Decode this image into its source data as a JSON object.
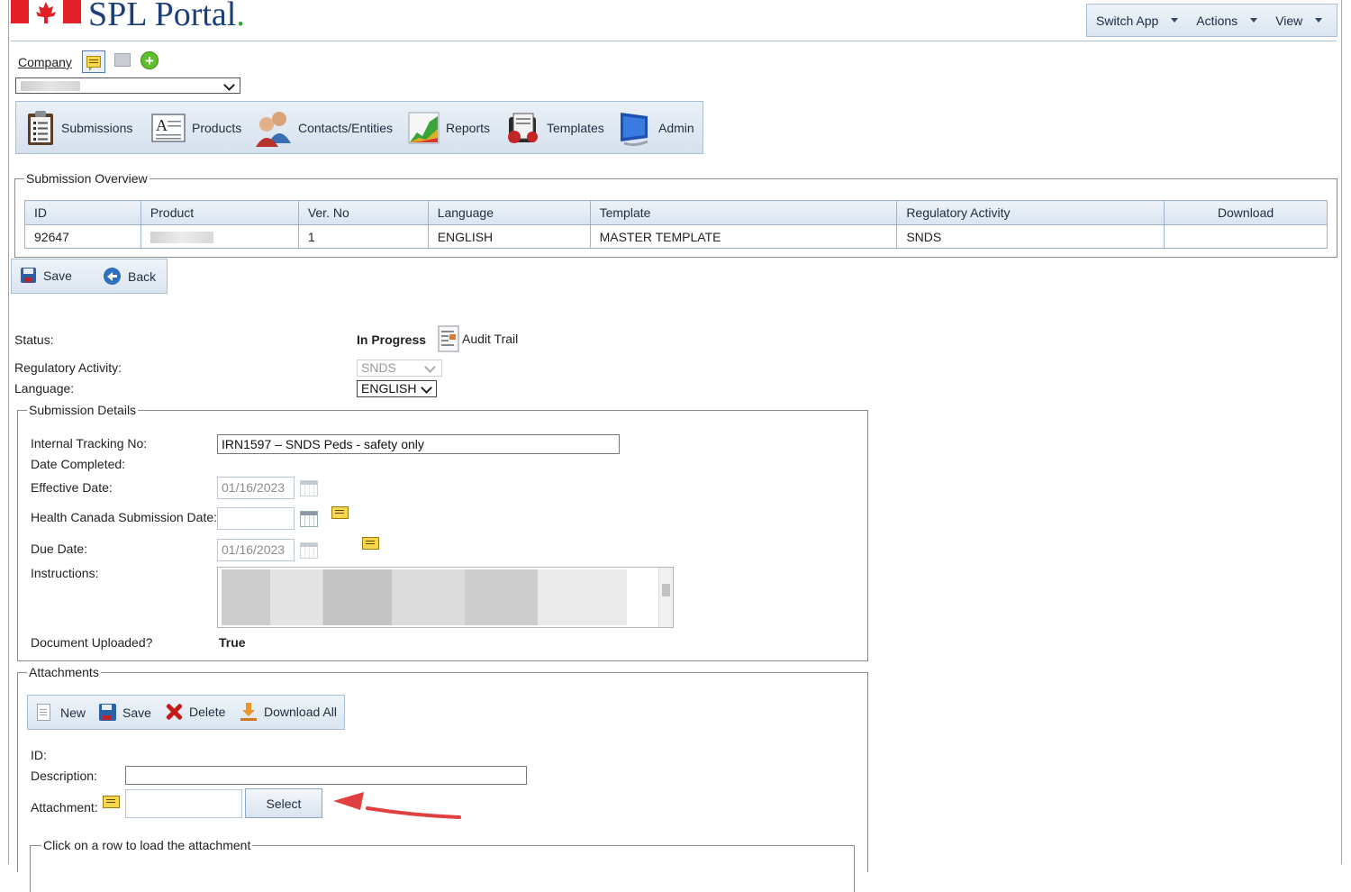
{
  "app": {
    "title": "SPL Portal"
  },
  "top_menu": {
    "items": [
      "Switch App",
      "Actions",
      "View"
    ]
  },
  "company": {
    "label": "Company"
  },
  "modules": [
    "Submissions",
    "Products",
    "Contacts/Entities",
    "Reports",
    "Templates",
    "Admin"
  ],
  "overview": {
    "legend": "Submission Overview",
    "columns": [
      "ID",
      "Product",
      "Ver. No",
      "Language",
      "Template",
      "Regulatory Activity",
      "Download"
    ],
    "row": {
      "id": "92647",
      "product": "",
      "ver": "1",
      "language": "ENGLISH",
      "template": "MASTER TEMPLATE",
      "activity": "SNDS",
      "download": ""
    }
  },
  "toolbar": {
    "save": "Save",
    "back": "Back"
  },
  "form": {
    "status_label": "Status:",
    "status_value": "In Progress",
    "audit_trail": "Audit Trail",
    "reg_activity_label": "Regulatory Activity:",
    "reg_activity_value": "SNDS",
    "language_label": "Language:",
    "language_value": "ENGLISH"
  },
  "details": {
    "legend": "Submission Details",
    "tracking_label": "Internal Tracking No:",
    "tracking_value": "IRN1597 – SNDS Peds - safety only",
    "date_completed_label": "Date Completed:",
    "effective_label": "Effective Date:",
    "effective_value": "01/16/2023",
    "hc_label": "Health Canada Submission Date:",
    "hc_value": "",
    "due_label": "Due Date:",
    "due_value": "01/16/2023",
    "instructions_label": "Instructions:",
    "uploaded_label": "Document Uploaded?",
    "uploaded_value": "True"
  },
  "attachments": {
    "legend": "Attachments",
    "toolbar": {
      "new": "New",
      "save": "Save",
      "delete": "Delete",
      "download_all": "Download All"
    },
    "id_label": "ID:",
    "description_label": "Description:",
    "attachment_label": "Attachment:",
    "select_button": "Select",
    "inner_legend": "Click on a row to load the attachment"
  }
}
